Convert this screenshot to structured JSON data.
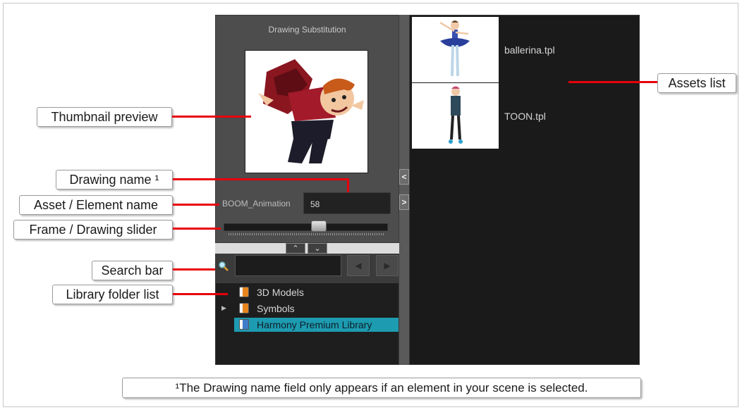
{
  "window": {
    "substitution_title": "Drawing Substitution",
    "asset_element_name": "BOOM_Animation",
    "drawing_name_value": "58",
    "slider_value_fraction": 0.58
  },
  "toolbar": {
    "collapse_up_icon": "chevron-up-icon",
    "collapse_down_icon": "chevron-down-icon",
    "panel_left_icon": "chevron-left-icon",
    "panel_right_icon": "chevron-right-icon",
    "up_glyph": "⌃",
    "down_glyph": "⌄",
    "left_glyph": "<",
    "right_glyph": ">",
    "prev_glyph": "◀",
    "next_glyph": "▶"
  },
  "search": {
    "placeholder": ""
  },
  "library_folders": [
    {
      "label": "3D Models",
      "icon": "book-icon",
      "selected": false
    },
    {
      "label": "Symbols",
      "icon": "book-icon",
      "selected": false,
      "expandable": true
    },
    {
      "label": "Harmony Premium Library",
      "icon": "book-icon",
      "selected": true
    }
  ],
  "assets": [
    {
      "label": "ballerina.tpl"
    },
    {
      "label": "TOON.tpl"
    }
  ],
  "callouts": {
    "thumbnail_preview": "Thumbnail preview",
    "drawing_name": "Drawing name ¹",
    "asset_element_name": "Asset / Element name",
    "frame_drawing_slider": "Frame / Drawing slider",
    "search_bar": "Search bar",
    "library_folder_list": "Library folder list",
    "assets_list": "Assets list"
  },
  "footnote": "¹The Drawing name field only appears if an element in your scene is selected.",
  "colors": {
    "leader_line": "#e8000b",
    "selection": "#1d9bb0",
    "panel_dark": "#1a1a1a",
    "panel_mid": "#4d4d4d"
  }
}
